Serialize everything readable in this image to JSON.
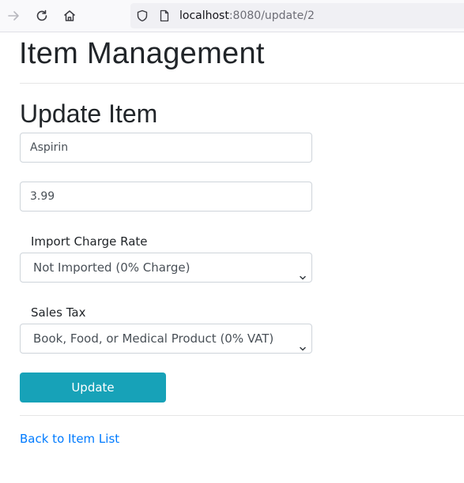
{
  "browser": {
    "url_host": "localhost",
    "url_path": ":8080/update/2",
    "icons": [
      "arrow-right-icon",
      "reload-icon",
      "home-icon",
      "shield-icon",
      "page-icon"
    ]
  },
  "page": {
    "title": "Item Management",
    "section_title": "Update Item"
  },
  "form": {
    "name_value": "Aspirin",
    "price_value": "3.99",
    "import_label": "Import Charge Rate",
    "import_selected": "Not Imported (0% Charge)",
    "tax_label": "Sales Tax",
    "tax_selected": "Book, Food, or Medical Product (0% VAT)",
    "submit_label": "Update"
  },
  "footer": {
    "back_link": "Back to Item List"
  },
  "colors": {
    "button": "#17a2b8",
    "link": "#007bff",
    "heading": "#212529"
  }
}
